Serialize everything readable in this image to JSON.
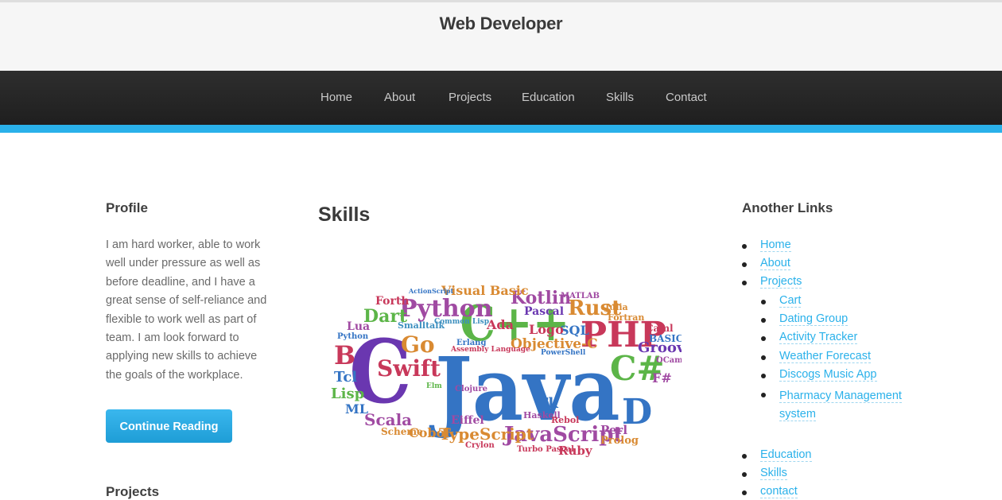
{
  "header": {
    "title": "Web Developer"
  },
  "nav": {
    "items": [
      {
        "label": "Home"
      },
      {
        "label": "About"
      },
      {
        "label": "Projects"
      },
      {
        "label": "Education"
      },
      {
        "label": "Skills"
      },
      {
        "label": "Contact"
      }
    ]
  },
  "sidebar": {
    "profile_title": "Profile",
    "profile_text": "I am hard worker, able to work well under pressure as well as before deadline, and I have a great sense of self-reliance and flexible to work well as part of team. I am look forward to applying new skills to achieve the goals of the workplace.",
    "continue_label": "Continue Reading",
    "projects_title": "Projects"
  },
  "main": {
    "title": "Skills",
    "word_cloud": {
      "words": [
        "Java",
        "C",
        "C++",
        "PHP",
        "Python",
        "JavaScript",
        "Swift",
        "Go",
        "Rust",
        "Kotlin",
        "C#",
        "D",
        "B",
        "Dart",
        "TypeScript",
        "Scala",
        "Tcl",
        "Lisp",
        "ML",
        "Ada",
        "Lua",
        "Groovy",
        "Perl",
        "Ruby",
        "Objective-C",
        "SQL",
        "Logo",
        "Pascal",
        "Forth",
        "Cobol",
        "Eiffel",
        "Tk",
        "Prolog",
        "Visual Basic",
        "Fortran",
        "Julia",
        "MATLAB",
        "BASIC",
        "Caml",
        "F#",
        "OCaml",
        "Scheme",
        "Haskell",
        "Erlang",
        "Smalltalk",
        "Clojure",
        "Rebol",
        "Crylon",
        "Turbo Pascal",
        "Assembly Language",
        "Common Lisp",
        "PowerShell",
        "ActionScript",
        "Python",
        "Elm"
      ],
      "colors": [
        "#3474c4",
        "#6a37b0",
        "#5cb548",
        "#c8385a",
        "#a04aa2",
        "#d98a32",
        "#3c8fbf"
      ]
    }
  },
  "links": {
    "title": "Another Links",
    "items": [
      {
        "label": "Home"
      },
      {
        "label": "About"
      },
      {
        "label": "Projects"
      },
      {
        "label": "Cart"
      },
      {
        "label": "Dating Group"
      },
      {
        "label": "Activity Tracker"
      },
      {
        "label": "Weather Forecast"
      },
      {
        "label": "Discogs Music App"
      },
      {
        "label": "Pharmacy Management system"
      },
      {
        "label": "Education"
      },
      {
        "label": "Skills"
      },
      {
        "label": "contact"
      }
    ]
  }
}
